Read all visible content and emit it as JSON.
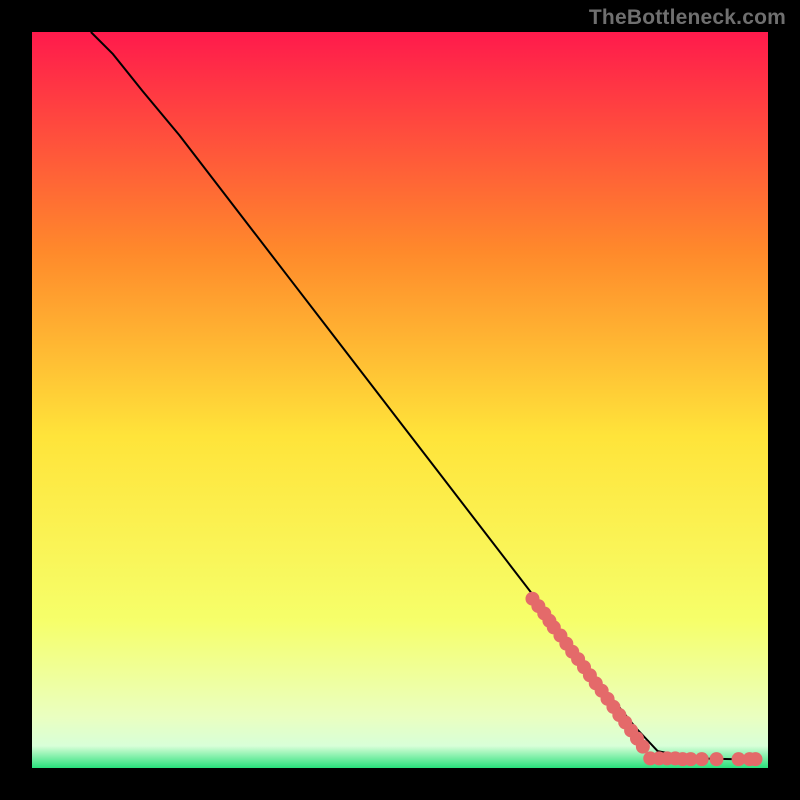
{
  "watermark": "TheBottleneck.com",
  "chart_data": {
    "type": "line",
    "title": "",
    "xlabel": "",
    "ylabel": "",
    "xlim": [
      0,
      100
    ],
    "ylim": [
      0,
      100
    ],
    "grid": false,
    "legend": false,
    "background_gradient": {
      "top": "#ff1a4c",
      "mid_upper": "#ff8a2b",
      "mid": "#ffe43a",
      "mid_lower": "#f6ff6a",
      "band_light": "#eaffc0",
      "band_pale": "#d8ffd8",
      "bottom": "#28e07b"
    },
    "series": [
      {
        "name": "curve",
        "type": "line",
        "color": "#000000",
        "x": [
          8,
          11,
          15,
          20,
          25,
          30,
          35,
          40,
          45,
          50,
          55,
          60,
          65,
          70,
          75,
          78,
          80,
          82,
          85,
          90,
          95,
          98
        ],
        "y": [
          100,
          97,
          92,
          86,
          79.5,
          73,
          66.5,
          60,
          53.5,
          47,
          40.5,
          34,
          27.5,
          21,
          14.5,
          10.5,
          8,
          5.5,
          2.3,
          1.3,
          1.2,
          1.2
        ]
      },
      {
        "name": "upper-dots",
        "type": "scatter",
        "color": "#e46a6a",
        "radius": 7,
        "x": [
          68.0,
          68.8,
          69.6,
          70.3,
          70.9,
          71.8,
          72.6,
          73.4,
          74.2,
          75.0,
          75.8,
          76.6,
          77.4,
          78.2,
          79.0,
          79.8,
          80.6,
          81.4,
          82.2,
          83.0
        ],
        "y": [
          23.0,
          22.0,
          21.0,
          20.0,
          19.1,
          18.0,
          16.9,
          15.8,
          14.8,
          13.7,
          12.6,
          11.5,
          10.5,
          9.4,
          8.3,
          7.2,
          6.2,
          5.1,
          4.0,
          2.9
        ]
      },
      {
        "name": "baseline-dots",
        "type": "scatter",
        "color": "#e46a6a",
        "radius": 7,
        "x": [
          84.0,
          85.2,
          86.3,
          87.4,
          88.4,
          89.5,
          91.0,
          93.0,
          96.0,
          97.5,
          98.3
        ],
        "y": [
          1.3,
          1.3,
          1.3,
          1.3,
          1.2,
          1.2,
          1.2,
          1.2,
          1.2,
          1.2,
          1.2
        ]
      }
    ]
  }
}
